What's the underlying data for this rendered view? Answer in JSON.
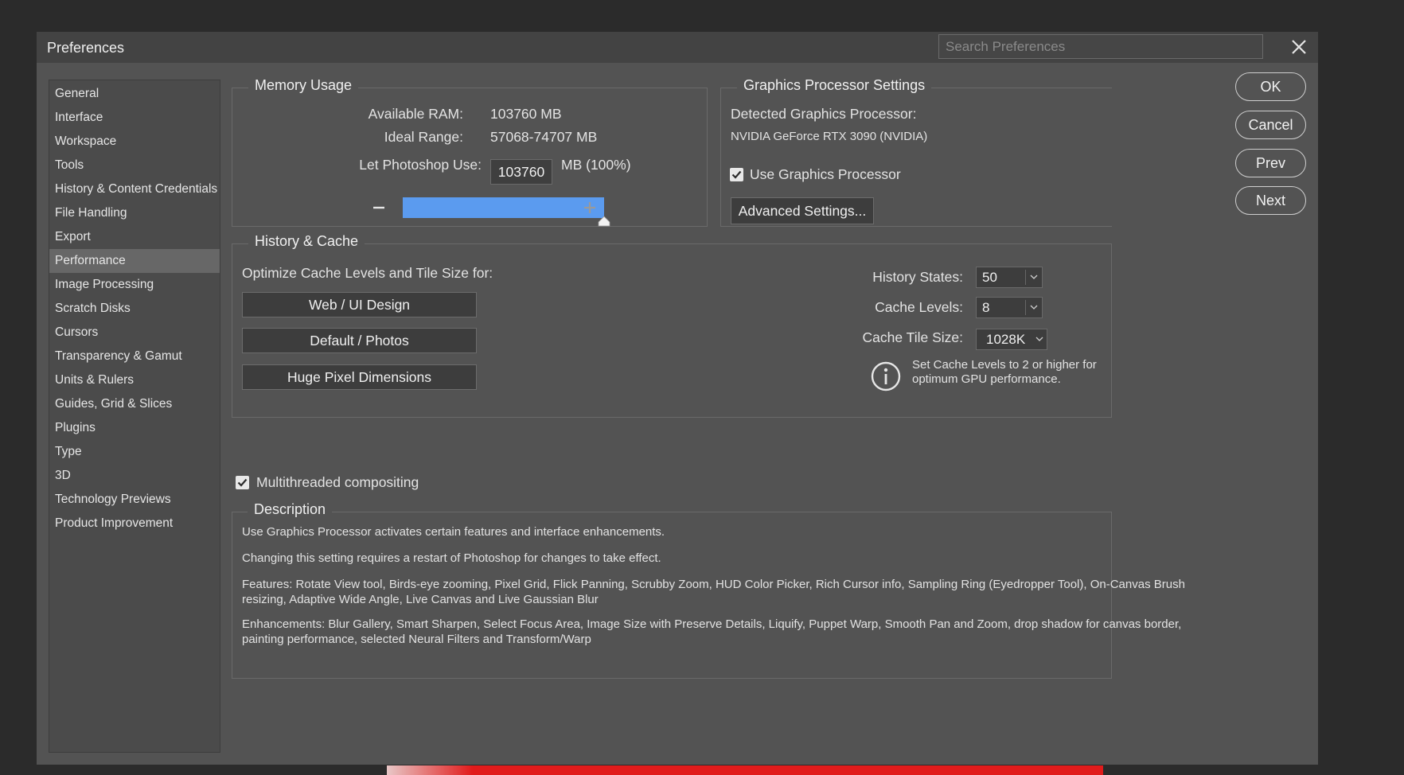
{
  "dialog": {
    "title": "Preferences",
    "search_placeholder": "Search Preferences"
  },
  "sidebar": {
    "items": [
      {
        "label": "General"
      },
      {
        "label": "Interface"
      },
      {
        "label": "Workspace"
      },
      {
        "label": "Tools"
      },
      {
        "label": "History & Content Credentials"
      },
      {
        "label": "File Handling"
      },
      {
        "label": "Export"
      },
      {
        "label": "Performance",
        "active": true
      },
      {
        "label": "Image Processing"
      },
      {
        "label": "Scratch Disks"
      },
      {
        "label": "Cursors"
      },
      {
        "label": "Transparency & Gamut"
      },
      {
        "label": "Units & Rulers"
      },
      {
        "label": "Guides, Grid & Slices"
      },
      {
        "label": "Plugins"
      },
      {
        "label": "Type"
      },
      {
        "label": "3D"
      },
      {
        "label": "Technology Previews"
      },
      {
        "label": "Product Improvement"
      }
    ]
  },
  "memory": {
    "legend": "Memory Usage",
    "available_label": "Available RAM:",
    "available_value": "103760 MB",
    "ideal_label": "Ideal Range:",
    "ideal_value": "57068-74707 MB",
    "use_label": "Let Photoshop Use:",
    "use_value": "103760",
    "use_suffix": "MB (100%)",
    "slider_percent": 100
  },
  "gpu": {
    "legend": "Graphics Processor Settings",
    "detected_label": "Detected Graphics Processor:",
    "detected_value": "NVIDIA GeForce RTX 3090 (NVIDIA)",
    "use_gpu_label": "Use Graphics Processor",
    "use_gpu_checked": true,
    "advanced_button": "Advanced Settings..."
  },
  "history_cache": {
    "legend": "History & Cache",
    "optimize_label": "Optimize Cache Levels and Tile Size for:",
    "buttons": [
      "Web / UI Design",
      "Default / Photos",
      "Huge Pixel Dimensions"
    ],
    "history_states_label": "History States:",
    "history_states_value": "50",
    "cache_levels_label": "Cache Levels:",
    "cache_levels_value": "8",
    "cache_tile_label": "Cache Tile Size:",
    "cache_tile_value": "1028K",
    "info_text": "Set Cache Levels to 2 or higher for optimum GPU performance."
  },
  "multithread": {
    "label": "Multithreaded compositing",
    "checked": true
  },
  "description": {
    "legend": "Description",
    "p1": "Use Graphics Processor activates certain features and interface enhancements.",
    "p2": "Changing this setting requires a restart of Photoshop for changes to take effect.",
    "p3": "Features: Rotate View tool, Birds-eye zooming, Pixel Grid, Flick Panning, Scrubby Zoom, HUD Color Picker, Rich Cursor info, Sampling Ring (Eyedropper Tool), On-Canvas Brush resizing, Adaptive Wide Angle, Live Canvas and Live Gaussian Blur",
    "p4": "Enhancements: Blur Gallery, Smart Sharpen, Select Focus Area, Image Size with Preserve Details, Liquify, Puppet Warp, Smooth Pan and Zoom, drop shadow for canvas border, painting performance, selected Neural Filters and Transform/Warp"
  },
  "actions": {
    "ok": "OK",
    "cancel": "Cancel",
    "prev": "Prev",
    "next": "Next"
  },
  "colors": {
    "dialog_bg": "#535353",
    "titlebar_bg": "#434343",
    "slider_fill": "#5b9bef",
    "accent_bar": "#e11b1b"
  },
  "icons": [
    "close-icon",
    "minus-icon",
    "plus-icon",
    "slider-handle-icon",
    "checkmark-icon",
    "chevron-down-icon",
    "info-icon"
  ]
}
